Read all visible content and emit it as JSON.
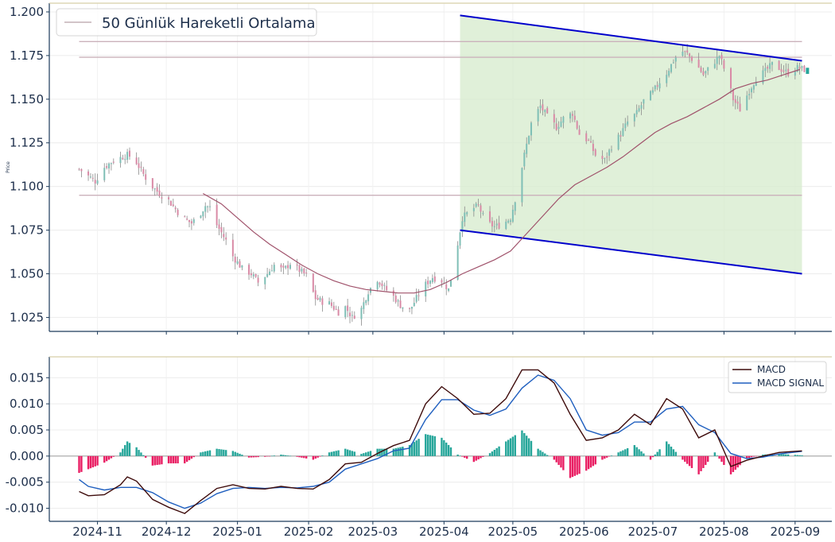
{
  "chart_data": [
    {
      "type": "candlestick",
      "ylabel": "Price",
      "ylim": [
        1.017,
        1.205
      ],
      "yticks": [
        "1.025",
        "1.050",
        "1.075",
        "1.100",
        "1.125",
        "1.150",
        "1.175",
        "1.200"
      ],
      "legend": {
        "label": "50 Günlük Hareketli Ortalama",
        "placement": "top-left"
      },
      "grid": true,
      "colors": {
        "up": "#26a69a",
        "down": "#e91e63",
        "wick": "#8a8a8a",
        "ma": "#a0526b",
        "channel_fill": "#d6ebcc",
        "channel_line": "#0000cc",
        "support": "#cbb2bb"
      },
      "horizontal_levels": [
        1.183,
        1.174,
        1.095
      ],
      "channel": {
        "upper": [
          [
            "2025-04-08",
            1.198
          ],
          [
            "2025-09-04",
            1.172
          ]
        ],
        "lower": [
          [
            "2025-04-08",
            1.075
          ],
          [
            "2025-09-04",
            1.05
          ]
        ]
      },
      "moving_average_50": [
        [
          "2024-12-17",
          1.096
        ],
        [
          "2024-12-25",
          1.09
        ],
        [
          "2025-01-01",
          1.082
        ],
        [
          "2025-01-08",
          1.074
        ],
        [
          "2025-01-15",
          1.067
        ],
        [
          "2025-01-22",
          1.061
        ],
        [
          "2025-01-29",
          1.055
        ],
        [
          "2025-02-05",
          1.05
        ],
        [
          "2025-02-12",
          1.046
        ],
        [
          "2025-02-19",
          1.043
        ],
        [
          "2025-02-26",
          1.041
        ],
        [
          "2025-03-05",
          1.04
        ],
        [
          "2025-03-12",
          1.039
        ],
        [
          "2025-03-19",
          1.039
        ],
        [
          "2025-03-26",
          1.041
        ],
        [
          "2025-04-02",
          1.045
        ],
        [
          "2025-04-09",
          1.05
        ],
        [
          "2025-04-16",
          1.054
        ],
        [
          "2025-04-23",
          1.058
        ],
        [
          "2025-04-30",
          1.063
        ],
        [
          "2025-05-07",
          1.073
        ],
        [
          "2025-05-14",
          1.083
        ],
        [
          "2025-05-21",
          1.093
        ],
        [
          "2025-05-28",
          1.101
        ],
        [
          "2025-06-04",
          1.106
        ],
        [
          "2025-06-11",
          1.111
        ],
        [
          "2025-06-18",
          1.117
        ],
        [
          "2025-06-25",
          1.124
        ],
        [
          "2025-07-02",
          1.131
        ],
        [
          "2025-07-09",
          1.136
        ],
        [
          "2025-07-16",
          1.14
        ],
        [
          "2025-07-23",
          1.145
        ],
        [
          "2025-07-30",
          1.15
        ],
        [
          "2025-08-06",
          1.156
        ],
        [
          "2025-08-13",
          1.159
        ],
        [
          "2025-08-20",
          1.161
        ],
        [
          "2025-08-27",
          1.164
        ],
        [
          "2025-09-03",
          1.167
        ]
      ],
      "price_path": [
        [
          "2024-10-24",
          1.11
        ],
        [
          "2024-10-27",
          1.107
        ],
        [
          "2024-10-31",
          1.103
        ],
        [
          "2024-11-04",
          1.111
        ],
        [
          "2024-11-07",
          1.114
        ],
        [
          "2024-11-10",
          1.116
        ],
        [
          "2024-11-14",
          1.118
        ],
        [
          "2024-11-17",
          1.116
        ],
        [
          "2024-11-21",
          1.107
        ],
        [
          "2024-11-24",
          1.101
        ],
        [
          "2024-11-28",
          1.096
        ],
        [
          "2024-12-02",
          1.092
        ],
        [
          "2024-12-05",
          1.087
        ],
        [
          "2024-12-08",
          1.082
        ],
        [
          "2024-12-12",
          1.079
        ],
        [
          "2024-12-15",
          1.083
        ],
        [
          "2024-12-18",
          1.089
        ],
        [
          "2024-12-20",
          1.088
        ],
        [
          "2024-12-23",
          1.078
        ],
        [
          "2024-12-27",
          1.069
        ],
        [
          "2024-12-30",
          1.06
        ],
        [
          "2025-01-03",
          1.053
        ],
        [
          "2025-01-07",
          1.05
        ],
        [
          "2025-01-10",
          1.045
        ],
        [
          "2025-01-14",
          1.05
        ],
        [
          "2025-01-17",
          1.055
        ],
        [
          "2025-01-21",
          1.052
        ],
        [
          "2025-01-24",
          1.056
        ],
        [
          "2025-01-28",
          1.052
        ],
        [
          "2025-01-31",
          1.049
        ],
        [
          "2025-02-04",
          1.036
        ],
        [
          "2025-02-07",
          1.034
        ],
        [
          "2025-02-10",
          1.033
        ],
        [
          "2025-02-14",
          1.028
        ],
        [
          "2025-02-17",
          1.031
        ],
        [
          "2025-02-20",
          1.025
        ],
        [
          "2025-02-24",
          1.03
        ],
        [
          "2025-02-27",
          1.04
        ],
        [
          "2025-03-03",
          1.047
        ],
        [
          "2025-03-06",
          1.042
        ],
        [
          "2025-03-10",
          1.037
        ],
        [
          "2025-03-13",
          1.032
        ],
        [
          "2025-03-17",
          1.029
        ],
        [
          "2025-03-20",
          1.036
        ],
        [
          "2025-03-24",
          1.044
        ],
        [
          "2025-03-27",
          1.048
        ],
        [
          "2025-03-31",
          1.046
        ],
        [
          "2025-04-03",
          1.041
        ],
        [
          "2025-04-06",
          1.06
        ],
        [
          "2025-04-09",
          1.082
        ],
        [
          "2025-04-13",
          1.087
        ],
        [
          "2025-04-16",
          1.089
        ],
        [
          "2025-04-19",
          1.08
        ],
        [
          "2025-04-23",
          1.077
        ],
        [
          "2025-04-26",
          1.078
        ],
        [
          "2025-04-30",
          1.082
        ],
        [
          "2025-05-03",
          1.098
        ],
        [
          "2025-05-06",
          1.118
        ],
        [
          "2025-05-09",
          1.136
        ],
        [
          "2025-05-13",
          1.146
        ],
        [
          "2025-05-16",
          1.14
        ],
        [
          "2025-05-20",
          1.134
        ],
        [
          "2025-05-23",
          1.139
        ],
        [
          "2025-05-27",
          1.142
        ],
        [
          "2025-05-30",
          1.13
        ],
        [
          "2025-06-03",
          1.126
        ],
        [
          "2025-06-06",
          1.118
        ],
        [
          "2025-06-10",
          1.115
        ],
        [
          "2025-06-13",
          1.123
        ],
        [
          "2025-06-17",
          1.13
        ],
        [
          "2025-06-20",
          1.137
        ],
        [
          "2025-06-24",
          1.142
        ],
        [
          "2025-06-27",
          1.149
        ],
        [
          "2025-07-01",
          1.154
        ],
        [
          "2025-07-04",
          1.16
        ],
        [
          "2025-07-07",
          1.165
        ],
        [
          "2025-07-10",
          1.172
        ],
        [
          "2025-07-13",
          1.178
        ],
        [
          "2025-07-16",
          1.176
        ],
        [
          "2025-07-20",
          1.17
        ],
        [
          "2025-07-23",
          1.164
        ],
        [
          "2025-07-27",
          1.17
        ],
        [
          "2025-07-30",
          1.175
        ],
        [
          "2025-08-02",
          1.164
        ],
        [
          "2025-08-05",
          1.15
        ],
        [
          "2025-08-08",
          1.144
        ],
        [
          "2025-08-12",
          1.155
        ],
        [
          "2025-08-15",
          1.162
        ],
        [
          "2025-08-19",
          1.166
        ],
        [
          "2025-08-22",
          1.17
        ],
        [
          "2025-08-26",
          1.167
        ],
        [
          "2025-08-29",
          1.165
        ],
        [
          "2025-09-02",
          1.168
        ],
        [
          "2025-09-05",
          1.167
        ]
      ],
      "last_candle_color": "#26a69a"
    },
    {
      "type": "macd",
      "yticks": [
        "-0.010",
        "-0.005",
        "0.000",
        "0.005",
        "0.010",
        "0.015"
      ],
      "ylim": [
        -0.0125,
        0.019
      ],
      "legend": [
        {
          "name": "MACD",
          "color": "#3d0a0a"
        },
        {
          "name": "MACD SIGNAL",
          "color": "#1f5fbf"
        }
      ],
      "placement": "top-right",
      "macd": [
        [
          "2024-10-24",
          -0.0068
        ],
        [
          "2024-10-28",
          -0.0076
        ],
        [
          "2024-11-04",
          -0.0074
        ],
        [
          "2024-11-11",
          -0.0055
        ],
        [
          "2024-11-14",
          -0.004
        ],
        [
          "2024-11-18",
          -0.0048
        ],
        [
          "2024-11-25",
          -0.0083
        ],
        [
          "2024-12-02",
          -0.0098
        ],
        [
          "2024-12-09",
          -0.011
        ],
        [
          "2024-12-16",
          -0.0085
        ],
        [
          "2024-12-23",
          -0.0062
        ],
        [
          "2024-12-30",
          -0.0055
        ],
        [
          "2025-01-06",
          -0.0062
        ],
        [
          "2025-01-13",
          -0.0063
        ],
        [
          "2025-01-20",
          -0.0058
        ],
        [
          "2025-01-27",
          -0.0062
        ],
        [
          "2025-02-03",
          -0.0063
        ],
        [
          "2025-02-10",
          -0.0045
        ],
        [
          "2025-02-17",
          -0.0015
        ],
        [
          "2025-02-24",
          -0.0012
        ],
        [
          "2025-03-03",
          0.0005
        ],
        [
          "2025-03-10",
          0.002
        ],
        [
          "2025-03-17",
          0.003
        ],
        [
          "2025-03-24",
          0.01
        ],
        [
          "2025-03-31",
          0.0133
        ],
        [
          "2025-04-07",
          0.011
        ],
        [
          "2025-04-14",
          0.008
        ],
        [
          "2025-04-21",
          0.0082
        ],
        [
          "2025-04-28",
          0.011
        ],
        [
          "2025-05-05",
          0.0165
        ],
        [
          "2025-05-12",
          0.0165
        ],
        [
          "2025-05-19",
          0.014
        ],
        [
          "2025-05-26",
          0.008
        ],
        [
          "2025-06-02",
          0.003
        ],
        [
          "2025-06-09",
          0.0035
        ],
        [
          "2025-06-16",
          0.005
        ],
        [
          "2025-06-23",
          0.008
        ],
        [
          "2025-06-30",
          0.006
        ],
        [
          "2025-07-07",
          0.011
        ],
        [
          "2025-07-14",
          0.009
        ],
        [
          "2025-07-21",
          0.0035
        ],
        [
          "2025-07-28",
          0.005
        ],
        [
          "2025-08-04",
          -0.002
        ],
        [
          "2025-08-11",
          -0.0008
        ],
        [
          "2025-08-18",
          0.0
        ],
        [
          "2025-08-25",
          0.0007
        ],
        [
          "2025-09-04",
          0.001
        ]
      ],
      "signal": [
        [
          "2024-10-24",
          -0.0045
        ],
        [
          "2024-10-28",
          -0.0058
        ],
        [
          "2024-11-04",
          -0.0065
        ],
        [
          "2024-11-11",
          -0.006
        ],
        [
          "2024-11-18",
          -0.006
        ],
        [
          "2024-11-25",
          -0.007
        ],
        [
          "2024-12-02",
          -0.0088
        ],
        [
          "2024-12-09",
          -0.01
        ],
        [
          "2024-12-16",
          -0.009
        ],
        [
          "2024-12-23",
          -0.0072
        ],
        [
          "2024-12-30",
          -0.0062
        ],
        [
          "2025-01-06",
          -0.006
        ],
        [
          "2025-01-13",
          -0.0062
        ],
        [
          "2025-01-20",
          -0.006
        ],
        [
          "2025-01-27",
          -0.0061
        ],
        [
          "2025-02-03",
          -0.0058
        ],
        [
          "2025-02-10",
          -0.005
        ],
        [
          "2025-02-17",
          -0.0025
        ],
        [
          "2025-02-24",
          -0.0015
        ],
        [
          "2025-03-03",
          -0.0005
        ],
        [
          "2025-03-10",
          0.001
        ],
        [
          "2025-03-17",
          0.0015
        ],
        [
          "2025-03-24",
          0.007
        ],
        [
          "2025-03-31",
          0.0108
        ],
        [
          "2025-04-07",
          0.0108
        ],
        [
          "2025-04-14",
          0.0088
        ],
        [
          "2025-04-21",
          0.0078
        ],
        [
          "2025-04-28",
          0.009
        ],
        [
          "2025-05-05",
          0.013
        ],
        [
          "2025-05-12",
          0.0155
        ],
        [
          "2025-05-19",
          0.0145
        ],
        [
          "2025-05-26",
          0.011
        ],
        [
          "2025-06-02",
          0.005
        ],
        [
          "2025-06-09",
          0.004
        ],
        [
          "2025-06-16",
          0.0045
        ],
        [
          "2025-06-23",
          0.0065
        ],
        [
          "2025-06-30",
          0.0065
        ],
        [
          "2025-07-07",
          0.009
        ],
        [
          "2025-07-14",
          0.0095
        ],
        [
          "2025-07-21",
          0.006
        ],
        [
          "2025-07-28",
          0.0045
        ],
        [
          "2025-08-04",
          0.0005
        ],
        [
          "2025-08-11",
          -0.0005
        ],
        [
          "2025-08-18",
          -0.0002
        ],
        [
          "2025-08-25",
          0.0004
        ],
        [
          "2025-09-04",
          0.0009
        ]
      ],
      "colors": {
        "hist_up": "#26a69a",
        "hist_down": "#e91e63"
      }
    }
  ],
  "xaxis": {
    "date_range": [
      "2024-10-11",
      "2025-09-17"
    ],
    "ticks": [
      {
        "date": "2024-11-01",
        "label": "2024-11"
      },
      {
        "date": "2024-12-01",
        "label": "2024-12"
      },
      {
        "date": "2025-01-01",
        "label": "2025-01"
      },
      {
        "date": "2025-02-01",
        "label": "2025-02"
      },
      {
        "date": "2025-03-01",
        "label": "2025-03"
      },
      {
        "date": "2025-04-01",
        "label": "2025-04"
      },
      {
        "date": "2025-05-01",
        "label": "2025-05"
      },
      {
        "date": "2025-06-01",
        "label": "2025-06"
      },
      {
        "date": "2025-07-01",
        "label": "2025-07"
      },
      {
        "date": "2025-08-01",
        "label": "2025-08"
      },
      {
        "date": "2025-09-01",
        "label": "2025-09"
      }
    ]
  }
}
